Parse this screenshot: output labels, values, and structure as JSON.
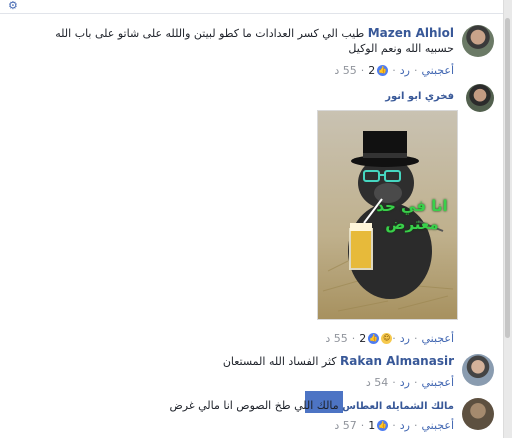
{
  "comments": [
    {
      "author": "Mazen Alhlol",
      "text": "طيب الي كسر العدادات ما كطو لبيتن واللله على شاتو على باب الله حسبيه الله ونعم الوكيل",
      "actions": {
        "like": "أعجبني",
        "reply": "رد",
        "reaction_count": "2",
        "time": "55 د",
        "separator": "·"
      }
    },
    {
      "author": "فخري ابو انور",
      "image_text": "انا في حد معترض",
      "actions": {
        "like": "أعجبني",
        "reply": "رد",
        "reaction_count": "2",
        "time": "55 د",
        "separator": "·"
      }
    },
    {
      "author": "Rakan Almanasir",
      "text": "كثر الفساد الله المستعان",
      "actions": {
        "like": "أعجبني",
        "reply": "رد",
        "time": "54 د",
        "separator": "·"
      }
    },
    {
      "author": "مالك الشمايله العطاس",
      "text": "مالك اللي طخ الصوص انا مالي غرض",
      "actions": {
        "like": "أعجبني",
        "reply": "رد",
        "reaction_count": "1",
        "time": "57 د",
        "separator": "·"
      }
    }
  ],
  "colors": {
    "link": "#385898",
    "action_link": "#4267b2",
    "meta": "#90949c",
    "censor": "#4d74c4"
  }
}
